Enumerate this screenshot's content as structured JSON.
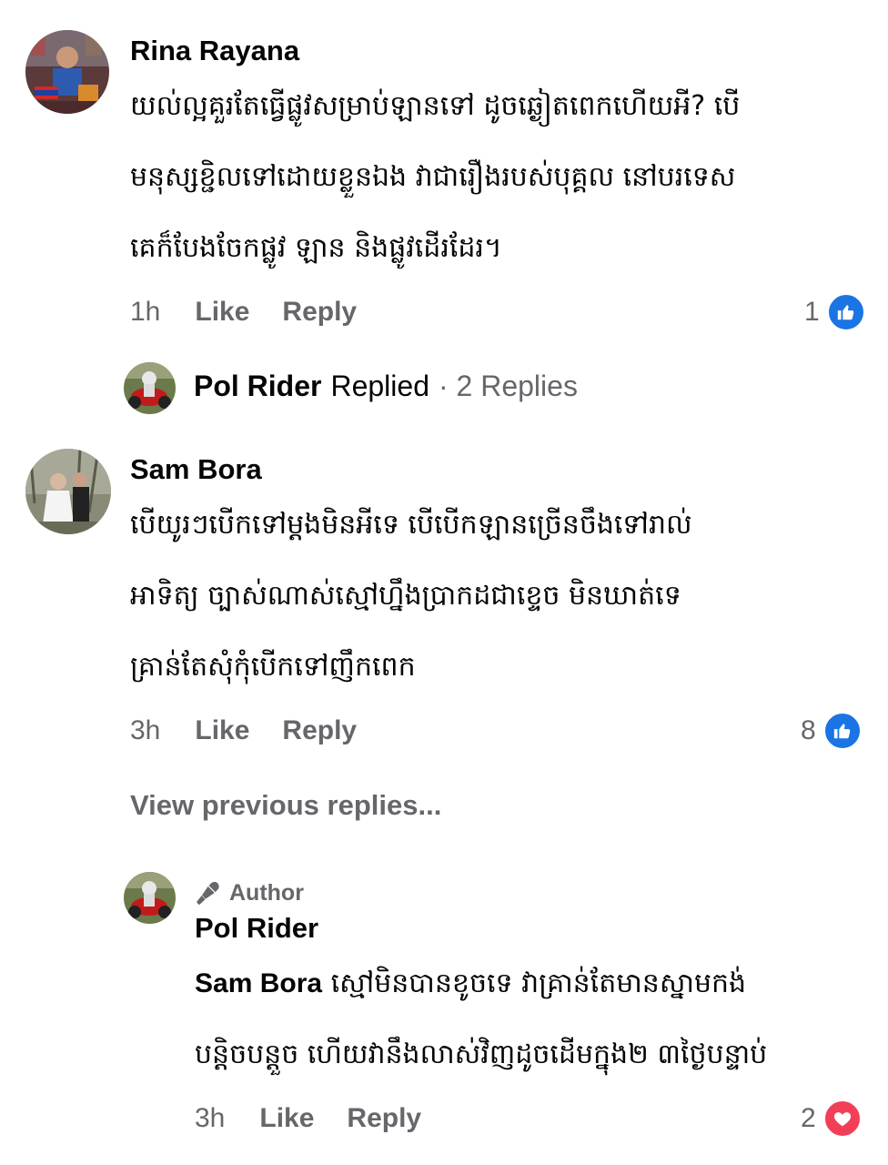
{
  "comments": [
    {
      "author": "Rina Rayana",
      "lines": [
        "យល់ល្អគួរតែធ្វើផ្លូវសម្រាប់ឡានទៅ ដូចឆ្ងៀតពេកហើយអី? បើ",
        "មនុស្សខ្ជិលទៅដោយខ្លួនឯង វាជារឿងរបស់បុគ្គល នៅបរទេស",
        "គេក៏បែងចែកផ្លូវ ឡាន និងផ្លូវដើរដែរ។"
      ],
      "time": "1h",
      "like_label": "Like",
      "reply_label": "Reply",
      "reaction_count": "1",
      "reaction_type": "like",
      "replied": {
        "name": "Pol Rider",
        "text": "Replied",
        "count": "· 2 Replies"
      }
    },
    {
      "author": "Sam Bora",
      "lines": [
        "បើយូរៗបើកទៅម្ដងមិនអីទេ បើបើកឡានច្រើនចឹងទៅរាល់",
        "អាទិត្យ ច្បាស់ណាស់ស្មៅហ្នឹងប្រាកដជាខ្ទេច មិនឃាត់ទេ",
        "គ្រាន់តែសុំកុំបើកទៅញឹកពេក"
      ],
      "time": "3h",
      "like_label": "Like",
      "reply_label": "Reply",
      "reaction_count": "8",
      "reaction_type": "like"
    }
  ],
  "view_previous": "View previous replies...",
  "reply": {
    "badge": "Author",
    "author": "Pol Rider",
    "mention": "Sam Bora",
    "line1_rest": "ស្មៅមិនបានខូចទេ វាគ្រាន់តែមានស្នាមកង់",
    "line2": "បន្តិចបន្តួច ហើយវានឹងលាស់វិញដូចដើមក្នុង២ ៣ថ្ងៃបន្ទាប់",
    "time": "3h",
    "like_label": "Like",
    "reply_label": "Reply",
    "reaction_count": "2",
    "reaction_type": "love"
  },
  "colors": {
    "like_blue": "#1b74e4",
    "love_red": "#f33e58",
    "meta_gray": "#65676b"
  }
}
